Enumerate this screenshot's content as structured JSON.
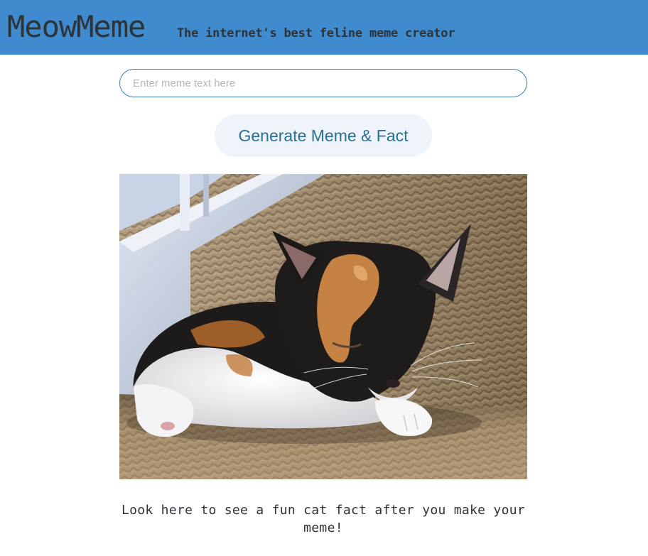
{
  "header": {
    "logo": "MeowMeme",
    "tagline": "The internet's best feline meme creator",
    "background_color": "#3f8bcd"
  },
  "form": {
    "input_value": "",
    "input_placeholder": "Enter meme text here",
    "generate_label": "Generate Meme & Fact"
  },
  "meme": {
    "image_alt": "calico kitten sleeping on carpeted stairs"
  },
  "fact": {
    "text": "Look here to see a fun cat fact after you make your meme!"
  }
}
